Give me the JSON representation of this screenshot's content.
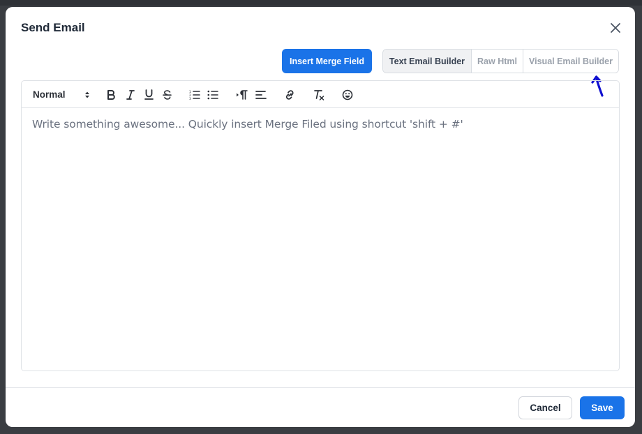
{
  "modal": {
    "title": "Send Email",
    "close_icon": "close-icon"
  },
  "actions": {
    "insert_merge_field": "Insert Merge Field"
  },
  "mode_tabs": [
    {
      "label": "Text Email Builder",
      "active": true
    },
    {
      "label": "Raw Html",
      "active": false
    },
    {
      "label": "Visual Email Builder",
      "active": false
    }
  ],
  "toolbar": {
    "format_value": "Normal",
    "tools": [
      "bold-icon",
      "italic-icon",
      "underline-icon",
      "strikethrough-icon",
      "ordered-list-icon",
      "bullet-list-icon",
      "text-direction-icon",
      "align-icon",
      "link-icon",
      "clear-format-icon",
      "emoji-icon"
    ]
  },
  "editor": {
    "placeholder": "Write something awesome... Quickly insert Merge Filed using shortcut 'shift + #'"
  },
  "footer": {
    "cancel_label": "Cancel",
    "save_label": "Save"
  },
  "colors": {
    "primary": "#1a73e8",
    "annotation_arrow": "#1010d0"
  }
}
